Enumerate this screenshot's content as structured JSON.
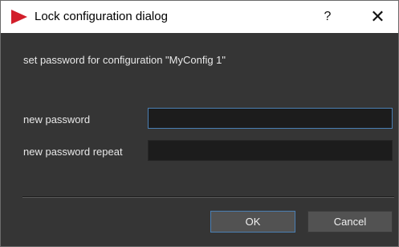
{
  "window": {
    "title": "Lock configuration dialog",
    "help_glyph": "?",
    "close_glyph": "✕",
    "icon": "red-triangle-play-icon",
    "accent_color": "#d21e2a"
  },
  "dialog": {
    "message": "set password for configuration \"MyConfig 1\"",
    "fields": [
      {
        "label": "new password",
        "value": ""
      },
      {
        "label": "new password repeat",
        "value": ""
      }
    ]
  },
  "buttons": {
    "ok": "OK",
    "cancel": "Cancel"
  }
}
